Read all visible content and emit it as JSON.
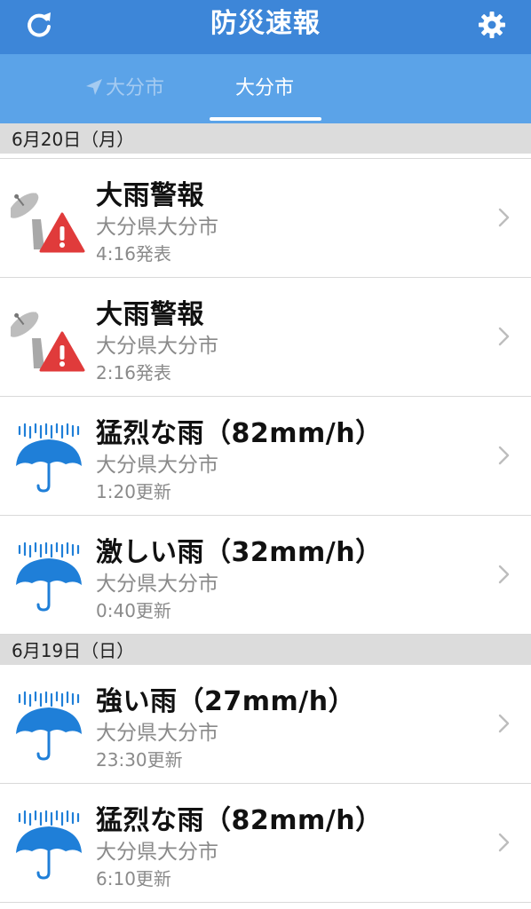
{
  "app": {
    "title": "防災速報"
  },
  "tabs": [
    {
      "label": "大分市",
      "icon": "location-arrow-icon",
      "selected": false
    },
    {
      "label": "大分市",
      "selected": true
    }
  ],
  "sections": [
    {
      "date": "6月20日（月）",
      "items": [
        {
          "icon": "warning-satellite-icon",
          "title": "大雨警報",
          "place": "大分県大分市",
          "time": "4:16発表"
        },
        {
          "icon": "warning-satellite-icon",
          "title": "大雨警報",
          "place": "大分県大分市",
          "time": "2:16発表"
        },
        {
          "icon": "umbrella-rain-icon",
          "title": "猛烈な雨（82mm/h）",
          "place": "大分県大分市",
          "time": "1:20更新"
        },
        {
          "icon": "umbrella-rain-icon",
          "title": "激しい雨（32mm/h）",
          "place": "大分県大分市",
          "time": "0:40更新"
        }
      ]
    },
    {
      "date": "6月19日（日）",
      "items": [
        {
          "icon": "umbrella-rain-icon",
          "title": "強い雨（27mm/h）",
          "place": "大分県大分市",
          "time": "23:30更新"
        },
        {
          "icon": "umbrella-rain-icon",
          "title": "猛烈な雨（82mm/h）",
          "place": "大分県大分市",
          "time": "6:10更新"
        }
      ]
    }
  ],
  "colors": {
    "header": "#3d86d8",
    "tabbar": "#5ba3e8",
    "warning_red": "#e03b3b",
    "umbrella_blue": "#1f7fd8"
  }
}
